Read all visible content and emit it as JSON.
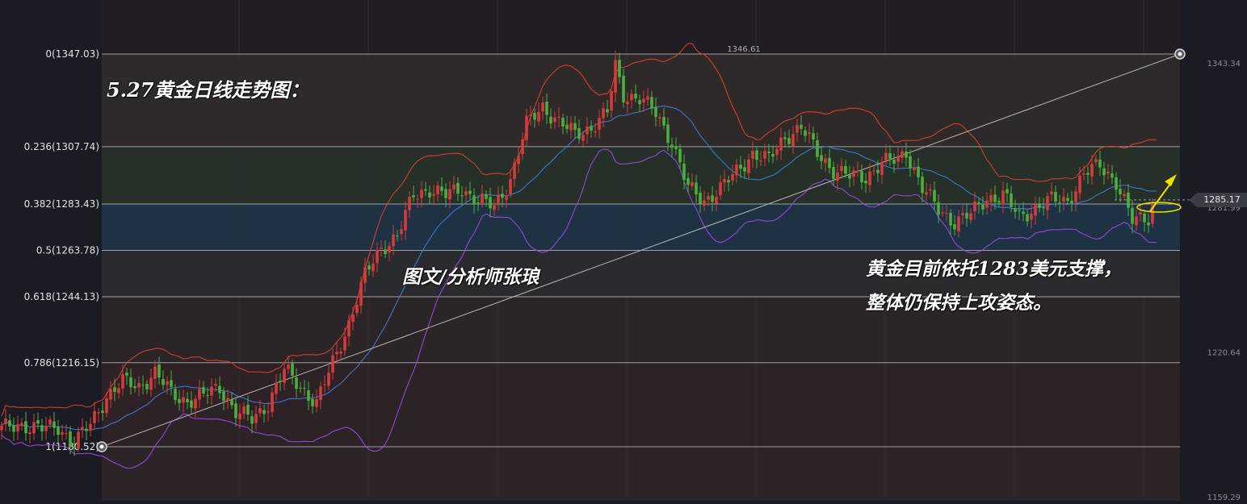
{
  "chart_data": {
    "type": "candlestick",
    "annotations": {
      "title": "5.27黄金日线走势图：",
      "watermark": "图文/分析师张琅",
      "note_line1": "黄金目前依托1283美元支撑，",
      "note_line2": "整体仍保持上攻姿态。"
    },
    "peak_label": "1346.61",
    "current_price": "1285.17",
    "fibonacci_levels": [
      {
        "label": "0(1347.03)",
        "price": 1347.03
      },
      {
        "label": "0.236(1307.74)",
        "price": 1307.74
      },
      {
        "label": "0.382(1283.43)",
        "price": 1283.43
      },
      {
        "label": "0.5(1263.78)",
        "price": 1263.78
      },
      {
        "label": "0.618(1244.13)",
        "price": 1244.13
      },
      {
        "label": "0.786(1216.15)",
        "price": 1216.15
      },
      {
        "label": "1(1180.52)",
        "price": 1180.52
      }
    ],
    "right_axis_ticks": [
      {
        "label": "1343.34",
        "price": 1343.34
      },
      {
        "label": "1281.99",
        "price": 1281.99
      },
      {
        "label": "1220.64",
        "price": 1220.64
      },
      {
        "label": "1159.29",
        "price": 1159.29
      }
    ],
    "y_range": [
      1158.0,
      1351.0
    ],
    "colors": {
      "up": "#d63b3b",
      "down": "#4caf3d",
      "upper_band": "#e0402e",
      "middle_band": "#3d7fe0",
      "lower_band": "#9b4be8",
      "fib_line": "#c8c8c8",
      "trendline": "#b8b8b8",
      "highlight": "#f0e000"
    },
    "waypoints": [
      [
        0,
        1188
      ],
      [
        5,
        1190
      ],
      [
        10,
        1188
      ],
      [
        14,
        1189
      ],
      [
        18,
        1182
      ],
      [
        22,
        1190
      ],
      [
        26,
        1202
      ],
      [
        30,
        1208
      ],
      [
        34,
        1206
      ],
      [
        38,
        1212
      ],
      [
        42,
        1203
      ],
      [
        46,
        1200
      ],
      [
        50,
        1202
      ],
      [
        54,
        1206
      ],
      [
        58,
        1195
      ],
      [
        62,
        1192
      ],
      [
        66,
        1199
      ],
      [
        70,
        1213
      ],
      [
        74,
        1206
      ],
      [
        78,
        1199
      ],
      [
        82,
        1216
      ],
      [
        86,
        1233
      ],
      [
        90,
        1253
      ],
      [
        94,
        1265
      ],
      [
        98,
        1270
      ],
      [
        102,
        1287
      ],
      [
        106,
        1290
      ],
      [
        110,
        1287
      ],
      [
        114,
        1290
      ],
      [
        118,
        1285
      ],
      [
        122,
        1282
      ],
      [
        126,
        1294
      ],
      [
        130,
        1317
      ],
      [
        134,
        1325
      ],
      [
        138,
        1318
      ],
      [
        142,
        1313
      ],
      [
        146,
        1316
      ],
      [
        150,
        1322
      ],
      [
        152,
        1342
      ],
      [
        154,
        1330
      ],
      [
        158,
        1328
      ],
      [
        162,
        1322
      ],
      [
        166,
        1310
      ],
      [
        170,
        1290
      ],
      [
        174,
        1285
      ],
      [
        178,
        1290
      ],
      [
        182,
        1297
      ],
      [
        186,
        1305
      ],
      [
        190,
        1302
      ],
      [
        194,
        1312
      ],
      [
        198,
        1316
      ],
      [
        202,
        1305
      ],
      [
        206,
        1298
      ],
      [
        210,
        1295
      ],
      [
        214,
        1295
      ],
      [
        218,
        1301
      ],
      [
        222,
        1302
      ],
      [
        224,
        1306
      ],
      [
        228,
        1290
      ],
      [
        232,
        1281
      ],
      [
        236,
        1276
      ],
      [
        240,
        1279
      ],
      [
        244,
        1286
      ],
      [
        248,
        1287
      ],
      [
        252,
        1278
      ],
      [
        256,
        1282
      ],
      [
        260,
        1285
      ],
      [
        264,
        1285
      ],
      [
        268,
        1296
      ],
      [
        272,
        1300
      ],
      [
        276,
        1293
      ],
      [
        280,
        1276
      ],
      [
        284,
        1278
      ],
      [
        286,
        1288
      ]
    ],
    "candle_count": 287
  }
}
